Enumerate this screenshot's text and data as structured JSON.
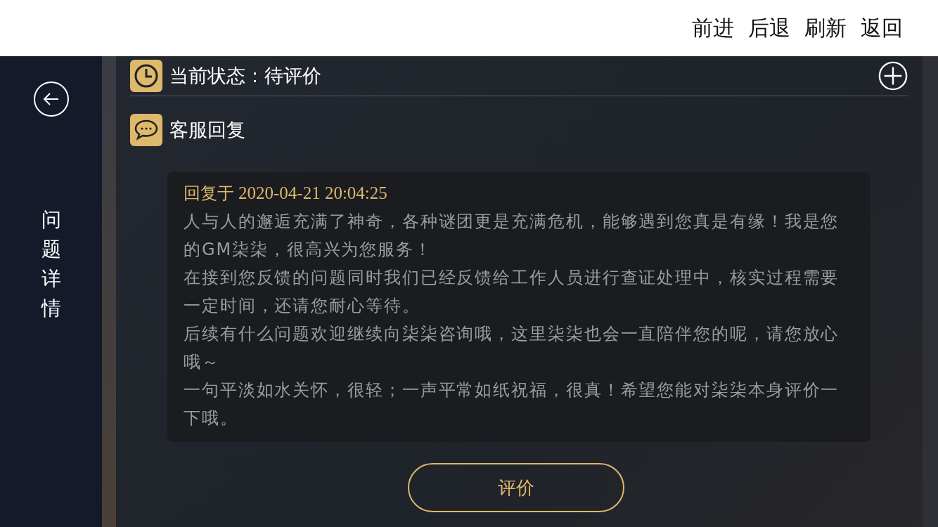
{
  "top_bar": {
    "links": [
      "前进",
      "后退",
      "刷新",
      "返回"
    ]
  },
  "sidebar": {
    "title": "问题详情"
  },
  "status": {
    "text": "当前状态：待评价"
  },
  "reply_section": {
    "title": "客服回复",
    "reply": {
      "label": "回复于",
      "time": "2020-04-21 20:04:25",
      "paragraphs": [
        "人与人的邂逅充满了神奇，各种谜团更是充满危机，能够遇到您真是有缘！我是您的GM柒柒，很高兴为您服务！",
        "在接到您反馈的问题同时我们已经反馈给工作人员进行查证处理中，核实过程需要一定时间，还请您耐心等待。",
        "后续有什么问题欢迎继续向柒柒咨询哦，这里柒柒也会一直陪伴您的呢，请您放心哦～",
        "一句平淡如水关怀，很轻；一声平常如纸祝福，很真！希望您能对柒柒本身评价一下哦。"
      ]
    }
  },
  "rate_button": "评价"
}
